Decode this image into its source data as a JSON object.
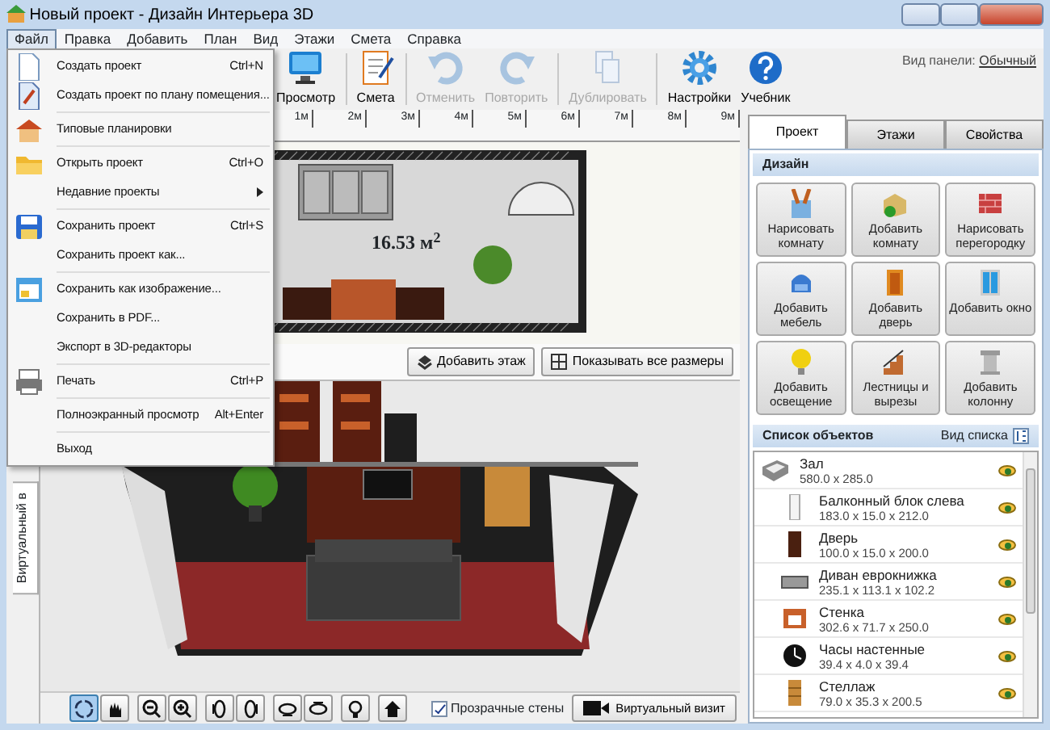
{
  "window": {
    "title": "Новый проект - Дизайн Интерьера 3D"
  },
  "menu_bar": [
    {
      "label": "Файл",
      "selected": true
    },
    {
      "label": "Правка",
      "selected": false
    },
    {
      "label": "Добавить",
      "selected": false
    },
    {
      "label": "План",
      "selected": false
    },
    {
      "label": "Вид",
      "selected": false
    },
    {
      "label": "Этажи",
      "selected": false
    },
    {
      "label": "Смета",
      "selected": false
    },
    {
      "label": "Справка",
      "selected": false
    }
  ],
  "file_menu": [
    {
      "items": [
        {
          "label": "Создать проект",
          "shortcut": "Ctrl+N"
        },
        {
          "label": "Создать проект по плану помещения..."
        }
      ]
    },
    {
      "items": [
        {
          "label": "Типовые планировки"
        }
      ]
    },
    {
      "items": [
        {
          "label": "Открыть проект",
          "shortcut": "Ctrl+O"
        },
        {
          "label": "Недавние проекты",
          "submenu": true
        }
      ]
    },
    {
      "items": [
        {
          "label": "Сохранить проект",
          "shortcut": "Ctrl+S"
        },
        {
          "label": "Сохранить проект как..."
        }
      ]
    },
    {
      "items": [
        {
          "label": "Сохранить как изображение..."
        },
        {
          "label": "Сохранить в  PDF..."
        },
        {
          "label": "Экспорт в 3D-редакторы"
        }
      ]
    },
    {
      "items": [
        {
          "label": "Печать",
          "shortcut": "Ctrl+P"
        }
      ]
    },
    {
      "items": [
        {
          "label": "Полноэкранный просмотр",
          "shortcut": "Alt+Enter"
        }
      ]
    },
    {
      "items": [
        {
          "label": "Выход"
        }
      ]
    }
  ],
  "toolbar": [
    [
      {
        "label": "Просмотр",
        "disabled": false
      }
    ],
    [
      {
        "label": "Смета",
        "disabled": false
      }
    ],
    [
      {
        "label": "Отменить",
        "disabled": true
      },
      {
        "label": "Повторить",
        "disabled": true
      }
    ],
    [
      {
        "label": "Дублировать",
        "disabled": true
      }
    ],
    [
      {
        "label": "Настройки",
        "disabled": false
      },
      {
        "label": "Учебник",
        "disabled": false
      }
    ]
  ],
  "panel_view": {
    "label": "Вид панели:",
    "value": "Обычный"
  },
  "ruler": [
    "1м",
    "2м",
    "3м",
    "4м",
    "5м",
    "6м",
    "7м",
    "8м",
    "9м"
  ],
  "plan": {
    "area": "16.53 м$^{2}$"
  },
  "plan_buttons": [
    "Добавить этаж",
    "Показывать все размеры"
  ],
  "side_tab": "Виртуальный в",
  "view_tools": [
    {
      "selected": true
    },
    {
      "selected": false
    },
    {
      "selected": false
    },
    {
      "selected": false
    },
    {
      "selected": false
    },
    {
      "selected": false
    },
    {
      "selected": false
    },
    {
      "selected": false
    },
    {
      "selected": false
    },
    {
      "selected": false
    }
  ],
  "transparent_walls": {
    "label": "Прозрачные стены",
    "checked": true
  },
  "virtual_visit_button": "Виртуальный визит",
  "right_tabs": [
    {
      "label": "Проект",
      "selected": true
    },
    {
      "label": "Этажи",
      "selected": false
    },
    {
      "label": "Свойства",
      "selected": false
    }
  ],
  "design": {
    "title": "Дизайн",
    "buttons": [
      "Нарисовать комнату",
      "Добавить комнату",
      "Нарисовать перегородку",
      "Добавить мебель",
      "Добавить дверь",
      "Добавить окно",
      "Добавить освещение",
      "Лестницы и вырезы",
      "Добавить колонну"
    ]
  },
  "objects": {
    "title": "Список объектов",
    "view_label": "Вид списка",
    "items": [
      {
        "name": "Зал",
        "size": "580.0 x 285.0",
        "children": [
          {
            "name": "Балконный блок слева",
            "size": "183.0 x 15.0 x 212.0"
          },
          {
            "name": "Дверь",
            "size": "100.0 x 15.0 x 200.0"
          },
          {
            "name": "Диван еврокнижка",
            "size": "235.1 x 113.1 x 102.2"
          },
          {
            "name": "Стенка",
            "size": "302.6 x 71.7 x 250.0"
          },
          {
            "name": "Часы настенные",
            "size": "39.4 x 4.0 x 39.4"
          },
          {
            "name": "Стеллаж",
            "size": "79.0 x 35.3 x 200.5"
          }
        ]
      }
    ]
  }
}
